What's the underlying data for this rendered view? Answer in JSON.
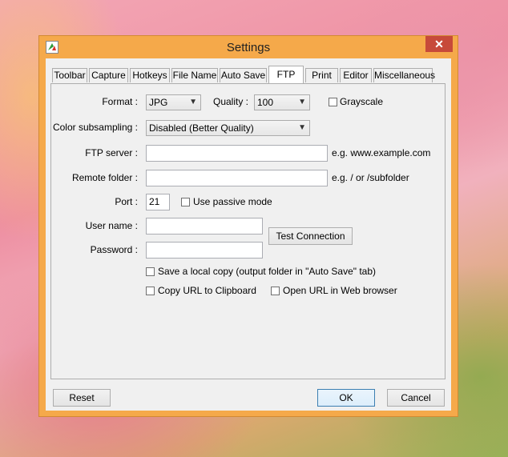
{
  "window": {
    "title": "Settings",
    "close_label": "✕"
  },
  "tabs": [
    {
      "label": "Toolbar"
    },
    {
      "label": "Capture"
    },
    {
      "label": "Hotkeys"
    },
    {
      "label": "File Name"
    },
    {
      "label": "Auto Save"
    },
    {
      "label": "FTP",
      "active": true
    },
    {
      "label": "Print"
    },
    {
      "label": "Editor"
    },
    {
      "label": "Miscellaneous"
    }
  ],
  "ftp": {
    "format_label": "Format :",
    "format_value": "JPG",
    "quality_label": "Quality :",
    "quality_value": "100",
    "grayscale_label": "Grayscale",
    "color_subsampling_label": "Color subsampling :",
    "color_subsampling_value": "Disabled (Better Quality)",
    "ftp_server_label": "FTP server :",
    "ftp_server_value": "",
    "ftp_server_hint": "e.g. www.example.com",
    "remote_folder_label": "Remote folder :",
    "remote_folder_value": "",
    "remote_folder_hint": "e.g. / or /subfolder",
    "port_label": "Port :",
    "port_value": "21",
    "passive_label": "Use passive mode",
    "username_label": "User name :",
    "username_value": "",
    "password_label": "Password :",
    "password_value": "",
    "test_connection_label": "Test Connection",
    "save_local_label": "Save a local copy (output folder in \"Auto Save\" tab)",
    "copy_url_label": "Copy URL to Clipboard",
    "open_url_label": "Open URL in Web browser"
  },
  "footer": {
    "reset_label": "Reset",
    "ok_label": "OK",
    "cancel_label": "Cancel"
  },
  "colors": {
    "titlebar": "#f5a94a",
    "close": "#c74a3a",
    "default_button_border": "#3c7fb1"
  }
}
